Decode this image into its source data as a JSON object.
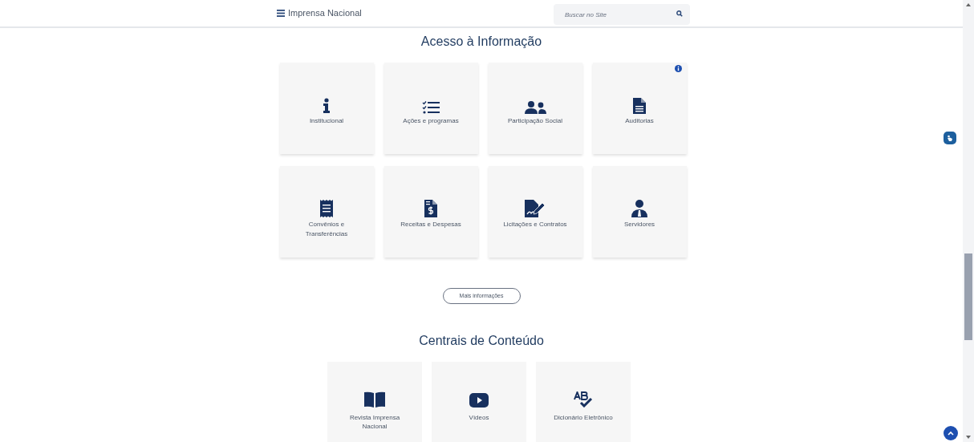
{
  "header": {
    "site_title": "Imprensa Nacional",
    "search": {
      "placeholder": "Buscar no Site"
    }
  },
  "acesso": {
    "heading": "Acesso à Informação",
    "cards": [
      {
        "label": "Institucional",
        "info_badge": false
      },
      {
        "label": "Ações e programas",
        "info_badge": false
      },
      {
        "label": "Participação Social",
        "info_badge": false
      },
      {
        "label": "Auditorias",
        "info_badge": true
      },
      {
        "label": "Convênios e Transferências",
        "info_badge": false
      },
      {
        "label": "Receitas e Despesas",
        "info_badge": false
      },
      {
        "label": "Licitações e Contratos",
        "info_badge": false
      },
      {
        "label": "Servidores",
        "info_badge": false
      }
    ],
    "more_button": "Mais informações"
  },
  "centrais": {
    "heading": "Centrais de Conteúdo",
    "cards": [
      {
        "label": "Revista Imprensa Nacional"
      },
      {
        "label": "Vídeos"
      },
      {
        "label": "Dicionário Eletrônico"
      }
    ]
  }
}
